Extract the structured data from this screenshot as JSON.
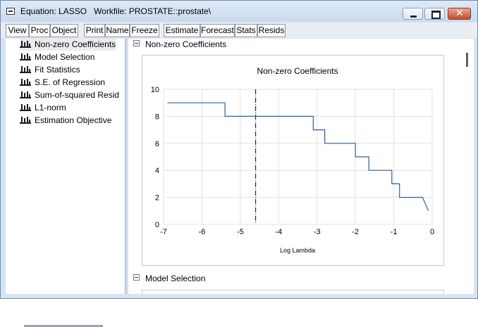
{
  "window": {
    "title": "Equation: LASSO   Workfile: PROSTATE::prostate\\"
  },
  "toolbar": [
    "View",
    "Proc",
    "Object",
    "Print",
    "Name",
    "Freeze",
    "Estimate",
    "Forecast",
    "Stats",
    "Resids"
  ],
  "tree": [
    {
      "label": "Non-zero Coefficients",
      "selected": true
    },
    {
      "label": "Model Selection"
    },
    {
      "label": "Fit Statistics"
    },
    {
      "label": "S.E. of Regression"
    },
    {
      "label": "Sum-of-squared Resid"
    },
    {
      "label": "L1-norm"
    },
    {
      "label": "Estimation Objective"
    }
  ],
  "sections": [
    "Non-zero Coefficients",
    "Model Selection"
  ],
  "chart_data": {
    "type": "line",
    "title": "Non-zero Coefficients",
    "xlabel": "Log Lambda",
    "ylabel": "",
    "xlim": [
      -7,
      0
    ],
    "ylim": [
      0,
      10
    ],
    "xticks": [
      -7,
      -6,
      -5,
      -4,
      -3,
      -2,
      -1,
      0
    ],
    "yticks": [
      0,
      2,
      4,
      6,
      8,
      10
    ],
    "grid": true,
    "line_color": "#2f5f9a",
    "vline": {
      "x": -4.6,
      "style": "dash-dot"
    },
    "series": [
      {
        "x": [
          -6.9,
          -5.4,
          -5.4,
          -3.1,
          -3.1,
          -2.8,
          -2.8,
          -2.0,
          -2.0,
          -1.65,
          -1.65,
          -1.05,
          -1.05,
          -0.85,
          -0.85,
          -0.25,
          -0.25,
          -0.1
        ],
        "y": [
          9,
          9,
          8,
          8,
          7,
          7,
          6,
          6,
          5,
          5,
          4,
          4,
          3,
          3,
          2,
          2,
          2,
          1
        ]
      }
    ]
  }
}
